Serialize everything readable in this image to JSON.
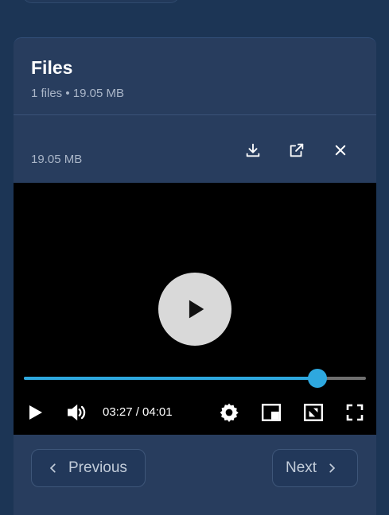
{
  "panel": {
    "title": "Files",
    "subtitle": "1 files • 19.05 MB"
  },
  "file": {
    "size": "19.05 MB",
    "actions": [
      {
        "name": "download-icon"
      },
      {
        "name": "open-external-icon"
      },
      {
        "name": "close-icon"
      }
    ]
  },
  "player": {
    "current_time": "03:27",
    "duration": "04:01",
    "time_display": "03:27 / 04:01",
    "progress_fraction": 0.857,
    "buffered_fraction": 0.07,
    "accent_color": "#2ea8df",
    "controls": [
      "play-icon",
      "volume-icon",
      "settings-icon",
      "picture-in-picture-icon",
      "resize-icon",
      "fullscreen-icon"
    ]
  },
  "navigation": {
    "previous_label": "Previous",
    "next_label": "Next"
  }
}
